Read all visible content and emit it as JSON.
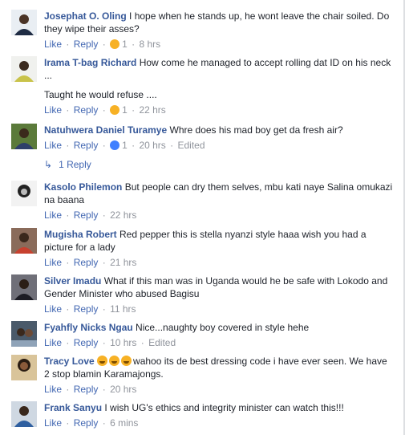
{
  "actions": {
    "like": "Like",
    "reply": "Reply",
    "separator": "·"
  },
  "comments": [
    {
      "author": "Josephat O. Oling",
      "paragraphs": [
        "I hope when he stands up, he wont leave the chair soiled. Do they wipe their asses?"
      ],
      "reaction": "haha",
      "reaction_count": "1",
      "time": "8 hrs",
      "edited": ""
    },
    {
      "author": "Irama T-bag Richard",
      "paragraphs": [
        "How come he managed to accept rolling dat ID on his neck ...",
        "Taught he would refuse ...."
      ],
      "reaction": "sad",
      "reaction_count": "1",
      "time": "22 hrs",
      "edited": ""
    },
    {
      "author": "Natuhwera Daniel Turamye",
      "paragraphs": [
        "Whre does his mad boy get da fresh air?"
      ],
      "reaction": "like",
      "reaction_count": "1",
      "time": "20 hrs",
      "edited": "Edited"
    },
    {
      "author": "Kasolo Philemon",
      "paragraphs": [
        "But people can dry them selves, mbu kati naye Salina omukazi na baana"
      ],
      "reaction": "",
      "reaction_count": "",
      "time": "22 hrs",
      "edited": ""
    },
    {
      "author": "Mugisha Robert",
      "paragraphs": [
        "Red pepper this is stella nyanzi style haaa wish you had a picture for a lady"
      ],
      "reaction": "",
      "reaction_count": "",
      "time": "21 hrs",
      "edited": ""
    },
    {
      "author": "Silver Imadu",
      "paragraphs": [
        "What if this man was in Uganda would he be safe with Lokodo and Gender Minister who abused Bagisu"
      ],
      "reaction": "",
      "reaction_count": "",
      "time": "11 hrs",
      "edited": ""
    },
    {
      "author": "Fyahfly Nicks Ngau",
      "paragraphs": [
        "Nice...naughty boy covered in style hehe"
      ],
      "reaction": "",
      "reaction_count": "",
      "time": "10 hrs",
      "edited": "Edited"
    },
    {
      "author": "Tracy Love",
      "paragraphs": [
        "wahoo its de best dressing code i have ever seen. We have 2 stop blamin Karamajongs."
      ],
      "reaction": "",
      "reaction_count": "",
      "time": "20 hrs",
      "edited": ""
    },
    {
      "author": "Frank Sanyu",
      "paragraphs": [
        "I wish UG's ethics and integrity minister can watch this!!!"
      ],
      "reaction": "",
      "reaction_count": "",
      "time": "6 mins",
      "edited": ""
    }
  ],
  "replies_link": "1 Reply",
  "colors": {
    "name": "#365899",
    "link": "#4267b2",
    "meta": "#90949c",
    "text": "#1d2129"
  }
}
